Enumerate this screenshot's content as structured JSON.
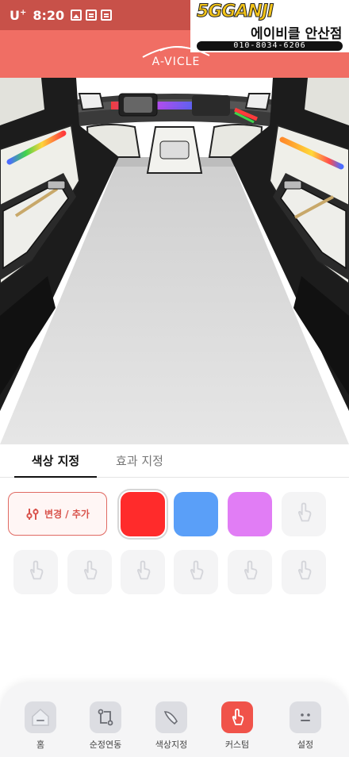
{
  "status_bar": {
    "carrier": "U",
    "carrier_sup": "+",
    "time": "8:20"
  },
  "header": {
    "logo_text": "A-VICLE",
    "sticker": {
      "brand": "5GGANJI",
      "shop": "에이비클 안산점",
      "phone": "010-8034-6206"
    }
  },
  "tabs": [
    {
      "label": "색상 지정",
      "active": true
    },
    {
      "label": "효과 지정",
      "active": false
    }
  ],
  "edit_button": {
    "label": "변경 / 추가",
    "icon": "sliders-icon"
  },
  "color_slots": {
    "colors": [
      {
        "hex": "#ff2b2b",
        "selected": true
      },
      {
        "hex": "#5a9ff8",
        "selected": false
      },
      {
        "hex": "#e17df5",
        "selected": false
      }
    ],
    "empty_icon": "hand-tap-icon",
    "empty_count": 7
  },
  "bottom_nav": [
    {
      "label": "홈",
      "icon": "home-icon",
      "active": false
    },
    {
      "label": "순정연동",
      "icon": "sync-icon",
      "active": false
    },
    {
      "label": "색상지정",
      "icon": "brush-icon",
      "active": false
    },
    {
      "label": "커스텀",
      "icon": "hand-tap-icon",
      "active": true
    },
    {
      "label": "설정",
      "icon": "settings-face-icon",
      "active": false
    }
  ],
  "colors": {
    "brand": "#f06e64",
    "status_bar": "#c85149",
    "accent": "#e06a63"
  }
}
